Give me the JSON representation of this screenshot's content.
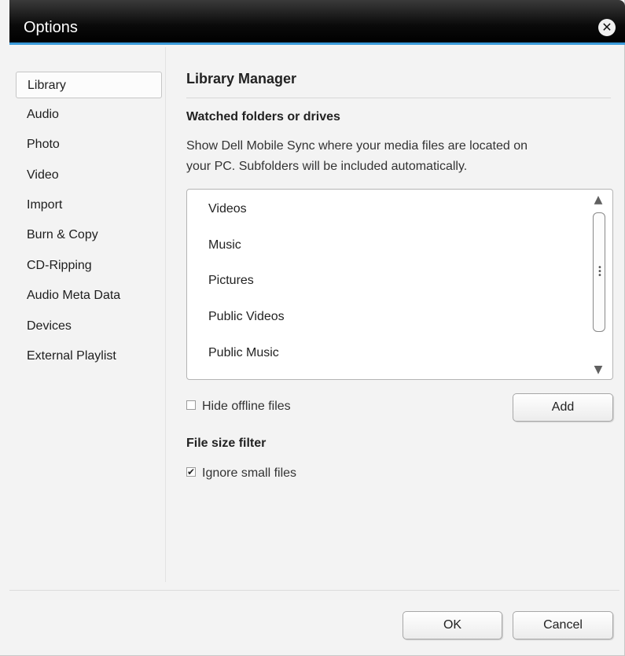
{
  "window": {
    "title": "Options",
    "close_glyph": "✕",
    "colors": {
      "accent": "#3a9ad9",
      "titlebar": "#000000",
      "background": "#f3f3f3"
    }
  },
  "sidebar": {
    "selected": "Library",
    "items": [
      {
        "label": "Library"
      },
      {
        "label": "Audio"
      },
      {
        "label": "Photo"
      },
      {
        "label": "Video"
      },
      {
        "label": "Import"
      },
      {
        "label": "Burn & Copy"
      },
      {
        "label": "CD-Ripping"
      },
      {
        "label": "Audio Meta Data"
      },
      {
        "label": "Devices"
      },
      {
        "label": "External Playlist"
      }
    ]
  },
  "main": {
    "heading": "Library Manager",
    "watched_heading": "Watched folders or drives",
    "watched_description_line1": "Show Dell Mobile Sync where your media files are located on",
    "watched_description_line2": "your PC. Subfolders will be included automatically.",
    "folders": [
      {
        "label": "Videos"
      },
      {
        "label": "Music"
      },
      {
        "label": "Pictures"
      },
      {
        "label": "Public Videos"
      },
      {
        "label": "Public Music"
      }
    ],
    "hide_offline": {
      "label": "Hide offline files",
      "checked": false
    },
    "add_button": "Add",
    "size_filter_heading": "File size filter",
    "ignore_small": {
      "label": "Ignore small files",
      "checked": true
    }
  },
  "footer": {
    "ok_button": "OK",
    "cancel_button": "Cancel"
  },
  "icons": {
    "scroll_up": "▲",
    "scroll_down": "▼",
    "check": "✔"
  }
}
